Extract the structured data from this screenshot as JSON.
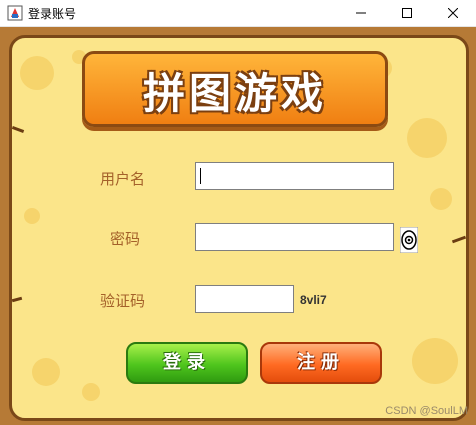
{
  "window": {
    "title": "登录账号",
    "app_icon": "java-app-icon",
    "controls": [
      "minimize-icon",
      "maximize-icon",
      "close-icon"
    ]
  },
  "logo": {
    "text": "拼图游戏"
  },
  "form": {
    "username_label": "用户名",
    "username_value": "",
    "password_label": "密码",
    "password_value": "",
    "captcha_label": "验证码",
    "captcha_value": "",
    "captcha_code": "8vli7",
    "show_password_icon": "eye-icon"
  },
  "buttons": {
    "login_label": "登录",
    "register_label": "注册"
  },
  "watermark": "CSDN @SoulLM",
  "colors": {
    "background": "#fbe58a",
    "frame": "#b67a36",
    "label": "#a4612a",
    "login": "#4fc51d",
    "register": "#ff6a22"
  }
}
